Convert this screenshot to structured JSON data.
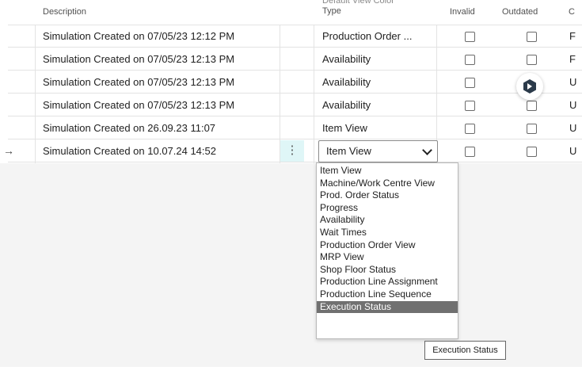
{
  "headers": {
    "description": "Description",
    "view_color_type_line1": "Default View Color",
    "view_color_type_line2": "Type",
    "invalid": "Invalid",
    "outdated": "Outdated",
    "next_col": "C"
  },
  "rows": [
    {
      "description": "Simulation Created on 07/05/23 12:12 PM",
      "type": "Production Order ...",
      "next": "F",
      "current": false
    },
    {
      "description": "Simulation Created on 07/05/23 12:13 PM",
      "type": "Availability",
      "next": "F",
      "current": false
    },
    {
      "description": "Simulation Created on 07/05/23 12:13 PM",
      "type": "Availability",
      "next": "U",
      "current": false
    },
    {
      "description": "Simulation Created on 07/05/23 12:13 PM",
      "type": "Availability",
      "next": "U",
      "current": false
    },
    {
      "description": "Simulation Created on 26.09.23 11:07",
      "type": "Item View",
      "next": "U",
      "current": false
    },
    {
      "description": "Simulation Created on 10.07.24 14:52",
      "type": "Item View",
      "next": "U",
      "current": true
    }
  ],
  "row_actions_glyph": "⋮",
  "current_row_glyph": "→",
  "dropdown": {
    "options": [
      "Item View",
      "Machine/Work Centre View",
      "Prod. Order Status",
      "Progress",
      "Availability",
      "Wait Times",
      "Production Order View",
      "MRP View",
      "Shop Floor Status",
      "Production Line Assignment",
      "Production Line Sequence",
      "Execution Status"
    ],
    "highlighted": "Execution Status"
  },
  "tooltip": "Execution Status",
  "icons": {
    "assistant": "copilot-hex-icon"
  },
  "colors": {
    "selected_option_bg": "#707070",
    "actions_cell_bg": "#dff6f7",
    "fab_hex": "#2b3a4a"
  }
}
